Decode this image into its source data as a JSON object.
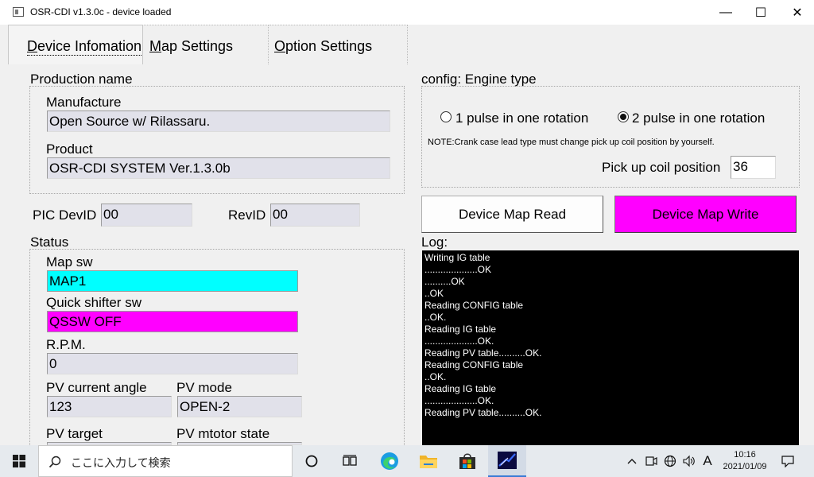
{
  "window": {
    "title": "OSR-CDI v1.3.0c - device loaded",
    "minimize": "—",
    "maximize": "☐",
    "close": "✕"
  },
  "tabs": [
    {
      "first": "D",
      "rest": "evice Infomation"
    },
    {
      "first": "M",
      "rest": "ap Settings"
    },
    {
      "first": "O",
      "rest": "ption Settings"
    }
  ],
  "production": {
    "heading": "Production name",
    "manufacture_label": "Manufacture",
    "manufacture_value": "Open Source w/ Rilassaru.",
    "product_label": "Product",
    "product_value": "OSR-CDI SYSTEM Ver.1.3.0b"
  },
  "ids": {
    "pic_devid_label": "PIC DevID",
    "pic_devid_value": "00",
    "revid_label": "RevID",
    "revid_value": "00"
  },
  "status": {
    "heading": "Status",
    "map_sw_label": "Map sw",
    "map_sw_value": "MAP1",
    "quick_shifter_label": "Quick shifter sw",
    "quick_shifter_value": "QSSW OFF",
    "rpm_label": "R.P.M.",
    "rpm_value": "0",
    "pv_angle_label": "PV current angle",
    "pv_angle_value": "123",
    "pv_mode_label": "PV mode",
    "pv_mode_value": "OPEN-2",
    "pv_target_label": "PV target",
    "pv_motor_label": "PV mtotor state"
  },
  "config": {
    "heading": "config: Engine type",
    "option1": "1 pulse in one rotation",
    "option2": "2 pulse in one rotation",
    "selected": "option2",
    "note": "NOTE:Crank case lead type must change pick up coil position by yourself.",
    "pickup_label": "Pick up coil position",
    "pickup_value": "36"
  },
  "buttons": {
    "read": "Device Map Read",
    "write": "Device Map Write"
  },
  "log": {
    "label": "Log:",
    "lines": [
      "Writing IG table",
      "....................OK",
      "..........OK",
      "..OK",
      "Reading CONFIG table",
      "..OK.",
      "Reading IG table",
      "....................OK.",
      "Reading PV table..........OK.",
      "Reading CONFIG table",
      "..OK.",
      "Reading IG table",
      "....................OK.",
      "Reading PV table..........OK."
    ]
  },
  "taskbar": {
    "search_placeholder": "ここに入力して検索",
    "ime": "A",
    "time": "10:16",
    "date": "2021/01/09"
  },
  "colors": {
    "map_sw": "#00ffff",
    "quick_shifter": "#ff00ff",
    "write_button": "#ff00ff",
    "log_bg": "#000000"
  }
}
